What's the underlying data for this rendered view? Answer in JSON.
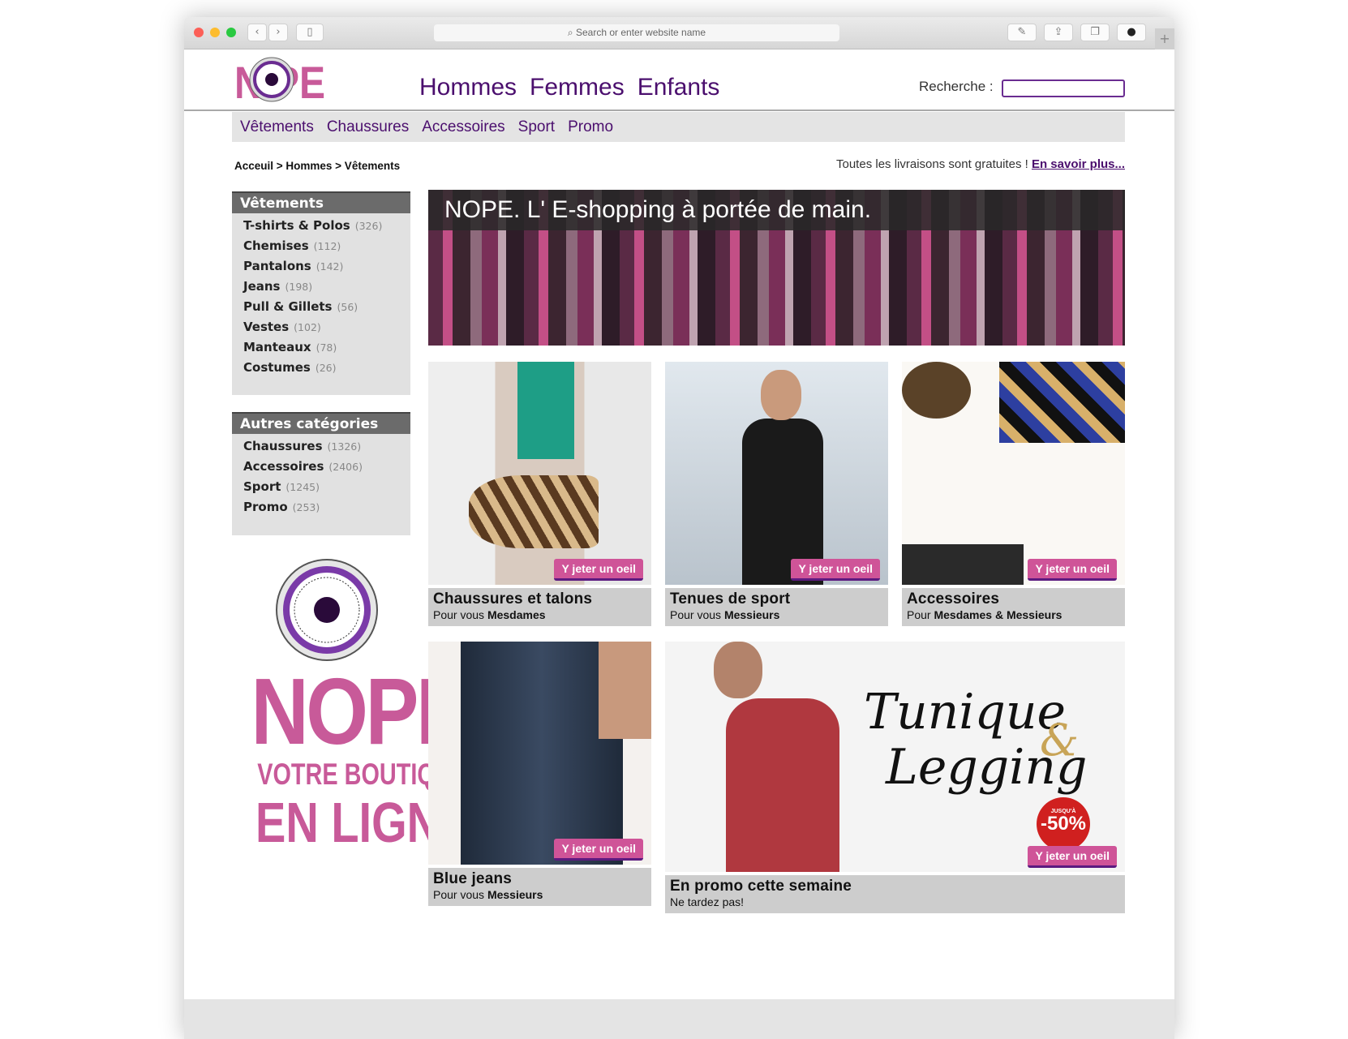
{
  "browser": {
    "url_placeholder": "Search or enter website name",
    "new_tab": "+"
  },
  "brand": {
    "logo_text": "NOPE",
    "tagline_line1": "VOTRE BOUTIQUE",
    "tagline_line2": "EN LIGNE",
    "colors": {
      "pink": "#c85a99",
      "purple": "#4b0f6e"
    }
  },
  "main_nav": [
    "Hommes",
    "Femmes",
    "Enfants"
  ],
  "search": {
    "label": "Recherche :",
    "value": ""
  },
  "sub_nav": [
    "Vêtements",
    "Chaussures",
    "Accessoires",
    "Sport",
    "Promo"
  ],
  "breadcrumb": "Acceuil > Hommes > Vêtements",
  "shipping": {
    "text": "Toutes les livraisons sont gratuites ! ",
    "link": "En savoir plus..."
  },
  "sidebar": {
    "vetements": {
      "title": "Vêtements",
      "items": [
        {
          "label": "T-shirts & Polos",
          "count": "(326)"
        },
        {
          "label": "Chemises",
          "count": "(112)"
        },
        {
          "label": "Pantalons",
          "count": "(142)"
        },
        {
          "label": "Jeans",
          "count": "(198)"
        },
        {
          "label": "Pull & Gillets",
          "count": "(56)"
        },
        {
          "label": "Vestes",
          "count": "(102)"
        },
        {
          "label": "Manteaux",
          "count": "(78)"
        },
        {
          "label": "Costumes",
          "count": "(26)"
        }
      ]
    },
    "autres": {
      "title": "Autres catégories",
      "items": [
        {
          "label": "Chaussures",
          "count": "(1326)"
        },
        {
          "label": "Accessoires",
          "count": "(2406)"
        },
        {
          "label": "Sport",
          "count": "(1245)"
        },
        {
          "label": "Promo",
          "count": "(253)"
        }
      ]
    }
  },
  "banner": {
    "title": "NOPE. L' E-shopping à portée de main."
  },
  "cta": "Y jeter un oeil",
  "cards": [
    {
      "title": "Chaussures et talons",
      "sub_prefix": "Pour vous ",
      "sub_bold": "Mesdames"
    },
    {
      "title": "Tenues de sport",
      "sub_prefix": "Pour vous ",
      "sub_bold": "Messieurs"
    },
    {
      "title": "Accessoires",
      "sub_prefix": "Pour ",
      "sub_bold": "Mesdames & Messieurs"
    },
    {
      "title": "Blue jeans",
      "sub_prefix": "Pour vous ",
      "sub_bold": "Messieurs"
    }
  ],
  "promo": {
    "title": "En promo cette semaine",
    "sub": "Ne tardez pas!",
    "image_title1": "Tunique",
    "image_amp": "&",
    "image_title2": "Legging",
    "badge_small": "JUSQU'À",
    "badge": "-50%"
  }
}
